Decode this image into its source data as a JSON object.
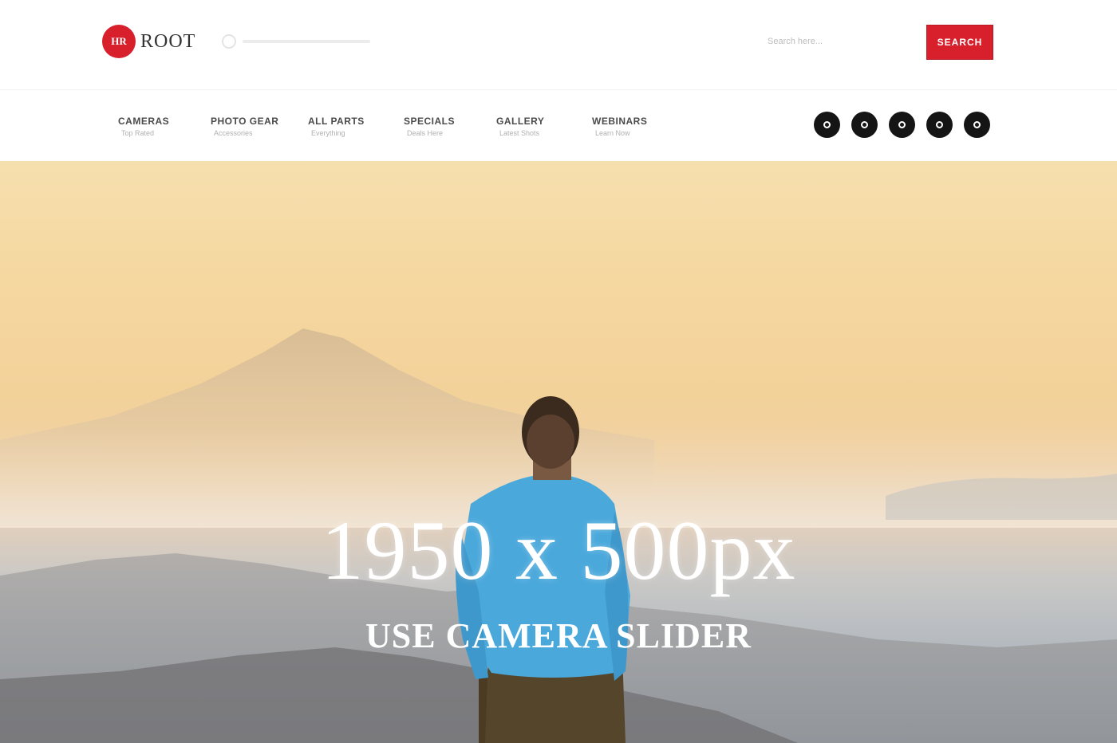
{
  "brand": {
    "logo_mark": "HR",
    "logo_word": "ROOT"
  },
  "header": {
    "tagline": "",
    "search_placeholder": "Search here...",
    "search_button": "SEARCH"
  },
  "nav": [
    {
      "title": "CAMERAS",
      "sub": "Top Rated"
    },
    {
      "title": "PHOTO GEAR",
      "sub": "Accessories"
    },
    {
      "title": "ALL PARTS",
      "sub": "Everything"
    },
    {
      "title": "SPECIALS",
      "sub": "Deals Here"
    },
    {
      "title": "GALLERY",
      "sub": "Latest Shots"
    },
    {
      "title": "WEBINARS",
      "sub": "Learn Now"
    }
  ],
  "social": [
    {
      "icon": "facebook-icon"
    },
    {
      "icon": "twitter-icon"
    },
    {
      "icon": "instagram-icon"
    },
    {
      "icon": "pinterest-icon"
    },
    {
      "icon": "youtube-icon"
    }
  ],
  "hero": {
    "title": "1950 x 500px",
    "subtitle": "USE CAMERA SLIDER"
  },
  "colors": {
    "accent": "#d8202d",
    "dark": "#151515",
    "sky": "#f5d79f",
    "shirt": "#4aa8db"
  }
}
